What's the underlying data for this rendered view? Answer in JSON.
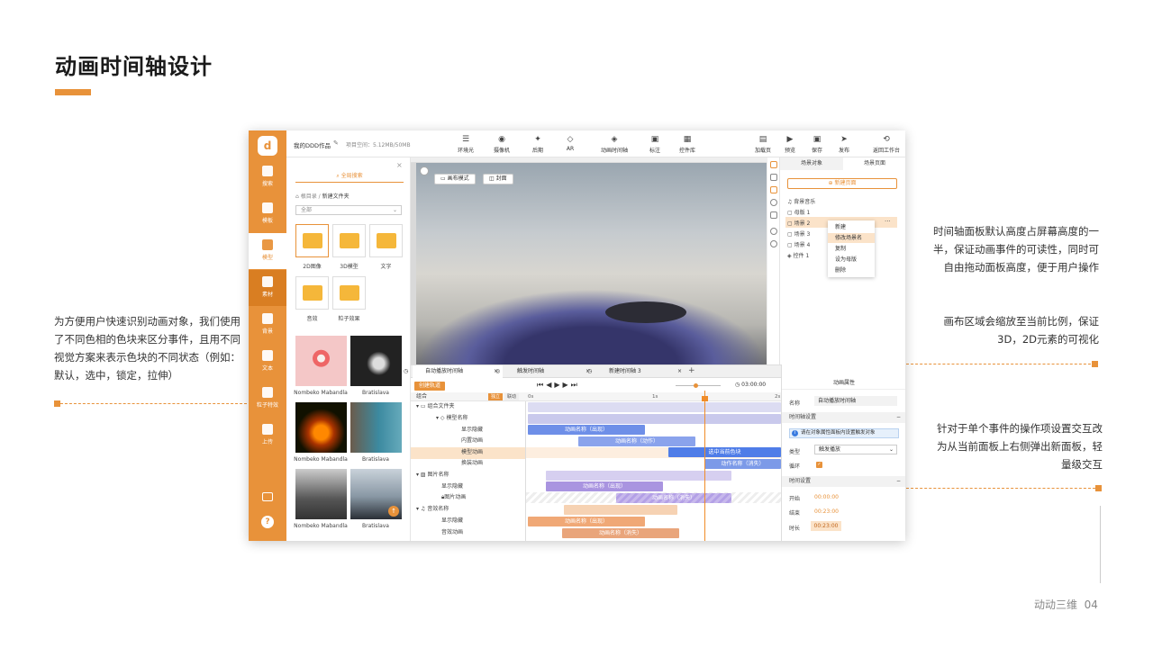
{
  "slide": {
    "title": "动画时间轴设计",
    "note_left": "为方便用户快速识别动画对象，我们使用了不同色相的色块来区分事件，且用不同视觉方案来表示色块的不同状态（例如：默认，选中，锁定，拉伸）",
    "note_right_1": "时间轴面板默认高度占屏幕高度的一半，保证动画事件的可读性，同时可自由拖动面板高度，便于用户操作",
    "note_right_2": "画布区域会缩放至当前比例，保证3D，2D元素的可视化",
    "note_right_3": "针对于单个事件的操作项设置交互改为从当前面板上右侧弹出新面板，轻量级交互",
    "footer_brand": "动动三维",
    "footer_page": "04",
    "accent": "#e8923a"
  },
  "app": {
    "nav": [
      "搜索",
      "模板",
      "模型",
      "素材",
      "背景",
      "文本",
      "粒子特效",
      "上传"
    ],
    "topbar": {
      "project_name": "我的DDD作品",
      "space": "项目空间：5.12MB/50MB",
      "tools": [
        "环境光",
        "摄像机",
        "后期",
        "AR",
        "动画时间轴",
        "标注",
        "控件库"
      ],
      "actions": [
        "加载页",
        "预览",
        "保存",
        "发布",
        "返回工作台"
      ]
    },
    "assets": {
      "search_label": "全局搜索",
      "breadcrumb_root": "根目录",
      "breadcrumb_current": "新建文件夹",
      "filter": "全部",
      "folders": [
        "2D图像",
        "3D模型",
        "文字",
        "音效",
        "粒子效果"
      ],
      "thumbs": [
        "Nombeko Mabandla",
        "Bratislava",
        "Nombeko Mabandla",
        "Bratislava",
        "Nombeko Mabandla",
        "Bratislava"
      ]
    },
    "canvas": {
      "btn_mode": "画布模式",
      "btn_cover": "封面"
    },
    "scene_panel": {
      "tab_objects": "场景对象",
      "tab_pages": "场景页面",
      "new_page": "新建页面",
      "items": [
        "背景音乐",
        "母版 1",
        "场景 2",
        "场景 3",
        "场景 4",
        "控件 1"
      ],
      "context_menu": [
        "新建",
        "修改场景名",
        "复制",
        "设为母版",
        "删除"
      ]
    },
    "timeline": {
      "tabs": [
        "自动播放时间轴",
        "触发时间轴",
        "新建时间轴 3"
      ],
      "create_track": "创建轨道",
      "time": "03:00:00",
      "tick_0": "0s",
      "tick_1": "1s",
      "tick_2": "2s",
      "group_label": "组合",
      "badge_solo": "独立",
      "badge_link": "联动",
      "rows": [
        "组合文件夹",
        "模型名称",
        "显示隐藏",
        "内置动画",
        "模型动画",
        "换装动画",
        "图片名称",
        "显示隐藏",
        "图片动画",
        "音效名称",
        "显示隐藏",
        "音效动画"
      ],
      "bars": {
        "appear": "动画名称（出现）",
        "action": "动画名称（动作）",
        "selected": "选中当前色块",
        "disappear": "动作名称（消失）",
        "img_appear": "动画名称（出现）",
        "img_disappear": "动画名称（消失）",
        "snd_appear": "动画名称（出现）",
        "snd_disappear": "动画名称（消失）"
      }
    },
    "props": {
      "title": "动画属性",
      "name_label": "名称",
      "name_value": "自动播放时间轴",
      "sec_timeline": "时间轴设置",
      "info": "请在对象属性面板内设置触发对象",
      "type_label": "类型",
      "type_value": "触发播放",
      "loop_label": "循环",
      "sec_time": "时间设置",
      "start_label": "开始",
      "start_value": "00:00:00",
      "end_label": "结束",
      "end_value": "00:23:00",
      "dur_label": "时长",
      "dur_value": "00:23:00"
    }
  }
}
